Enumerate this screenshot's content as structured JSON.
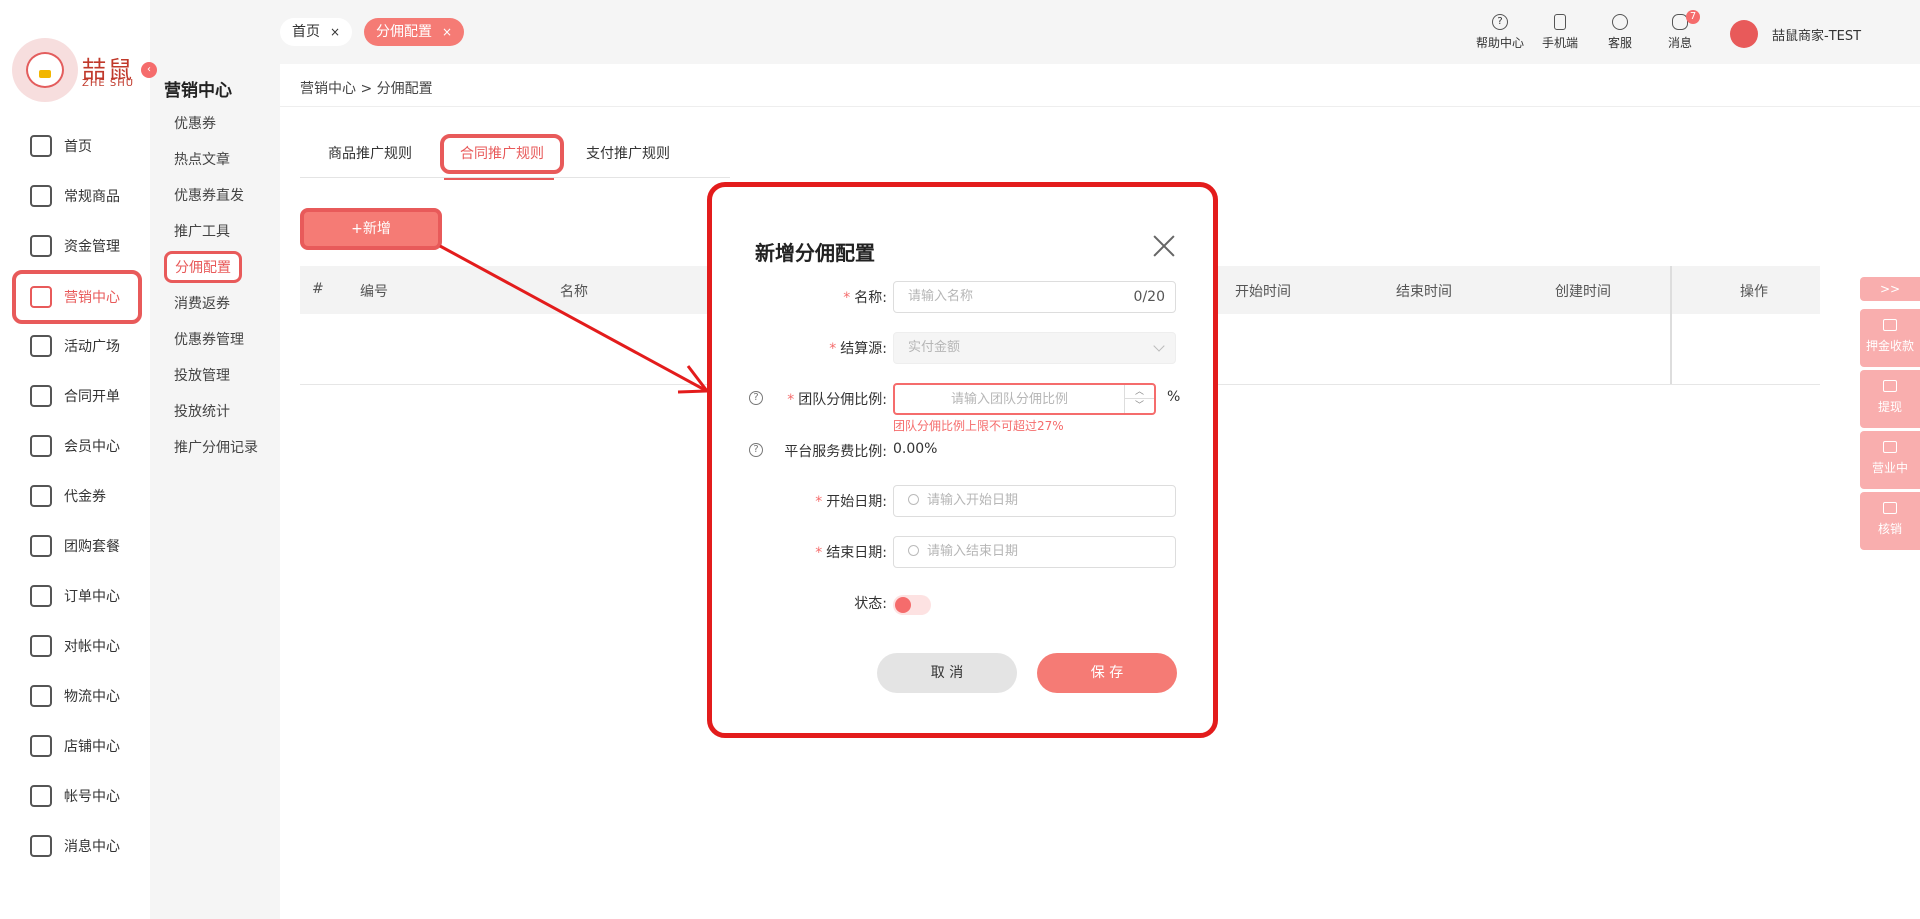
{
  "brand": {
    "logo_text": "喆鼠",
    "logo_sub": "ZHE SHU"
  },
  "main_nav": [
    {
      "label": "首页",
      "icon": "home-icon"
    },
    {
      "label": "常规商品",
      "icon": "cart-icon"
    },
    {
      "label": "资金管理",
      "icon": "layers-icon"
    },
    {
      "label": "营销中心",
      "icon": "marketing-icon",
      "active": true
    },
    {
      "label": "活动广场",
      "icon": "activity-icon"
    },
    {
      "label": "合同开单",
      "icon": "contract-icon"
    },
    {
      "label": "会员中心",
      "icon": "vip-icon"
    },
    {
      "label": "代金券",
      "icon": "voucher-icon"
    },
    {
      "label": "团购套餐",
      "icon": "group-buy-icon"
    },
    {
      "label": "订单中心",
      "icon": "order-icon"
    },
    {
      "label": "对帐中心",
      "icon": "yen-icon"
    },
    {
      "label": "物流中心",
      "icon": "box-icon"
    },
    {
      "label": "店铺中心",
      "icon": "store-icon"
    },
    {
      "label": "帐号中心",
      "icon": "user-icon"
    },
    {
      "label": "消息中心",
      "icon": "chat-icon"
    }
  ],
  "sub_nav": {
    "title": "营销中心",
    "items": [
      "优惠券",
      "热点文章",
      "优惠券直发",
      "推广工具",
      "分佣配置",
      "消费返券",
      "优惠券管理",
      "投放管理",
      "投放统计",
      "推广分佣记录"
    ],
    "active": "分佣配置"
  },
  "top_tabs": {
    "home": "首页",
    "current": "分佣配置",
    "close": "×"
  },
  "toolbar": [
    {
      "label": "帮助中心",
      "icon": "help-circle-icon"
    },
    {
      "label": "手机端",
      "icon": "mobile-icon"
    },
    {
      "label": "客服",
      "icon": "headset-icon"
    },
    {
      "label": "消息",
      "icon": "message-icon",
      "badge": "7"
    }
  ],
  "user": {
    "name": "喆鼠商家-TEST"
  },
  "breadcrumb": "营销中心 > 分佣配置",
  "rule_tabs": [
    "商品推广规则",
    "合同推广规则",
    "支付推广规则"
  ],
  "active_rule_tab": "合同推广规则",
  "add_button": "+新增",
  "table_headers": [
    "#",
    "编号",
    "名称",
    "开始时间",
    "结束时间",
    "创建时间",
    "操作"
  ],
  "right_float": {
    "expand": ">>",
    "items": [
      {
        "label": "押金收款",
        "icon": "card-icon"
      },
      {
        "label": "提现",
        "icon": "bookmark-icon"
      },
      {
        "label": "营业中",
        "icon": "shop-icon"
      },
      {
        "label": "核销",
        "icon": "bookmark-icon"
      }
    ]
  },
  "modal": {
    "title": "新增分佣配置",
    "name_label": "名称:",
    "name_placeholder": "请输入名称",
    "name_counter": "0/20",
    "source_label": "结算源:",
    "source_value": "实付金额",
    "team_label": "团队分佣比例:",
    "team_placeholder": "请输入团队分佣比例",
    "team_unit": "%",
    "team_error": "团队分佣比例上限不可超过27%",
    "platform_label": "平台服务费比例:",
    "platform_value": "0.00%",
    "start_label": "开始日期:",
    "start_placeholder": "请输入开始日期",
    "end_label": "结束日期:",
    "end_placeholder": "请输入结束日期",
    "status_label": "状态:",
    "status_on": false,
    "cancel": "取 消",
    "save": "保 存",
    "required_mark": "*",
    "help_mark": "?"
  },
  "colors": {
    "accent": "#f57b75",
    "highlight": "#e31c1c",
    "error": "#f56c6c"
  }
}
